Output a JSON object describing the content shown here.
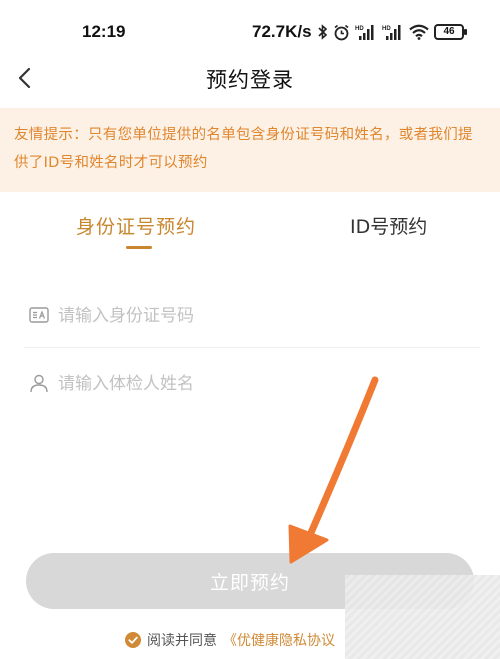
{
  "status_bar": {
    "time": "12:19",
    "network_speed": "72.7K/s",
    "battery_level": "46",
    "icons": [
      "bluetooth-icon",
      "alarm-icon",
      "signal-hd-icon",
      "signal-hd-icon",
      "wifi-icon",
      "battery-icon"
    ]
  },
  "nav": {
    "back_icon": "chevron-left-icon",
    "title": "预约登录"
  },
  "notice": {
    "text": "友情提示：只有您单位提供的名单包含身份证号码和姓名，或者我们提供了ID号和姓名时才可以预约"
  },
  "tabs": [
    {
      "label": "身份证号预约",
      "active": true
    },
    {
      "label": "ID号预约",
      "active": false
    }
  ],
  "form": {
    "id_card": {
      "placeholder": "请输入身份证号码",
      "value": "",
      "icon": "id-card-icon"
    },
    "name": {
      "placeholder": "请输入体检人姓名",
      "value": "",
      "icon": "person-icon"
    }
  },
  "submit": {
    "label": "立即预约"
  },
  "agreement": {
    "checked": true,
    "prefix": "阅读并同意",
    "link": "《优健康隐私协议"
  },
  "colors": {
    "accent": "#c8862e",
    "notice_bg": "#fdf1e6",
    "notice_text": "#e0862d",
    "button_disabled": "#d8d8d8",
    "arrow": "#f07a33"
  }
}
